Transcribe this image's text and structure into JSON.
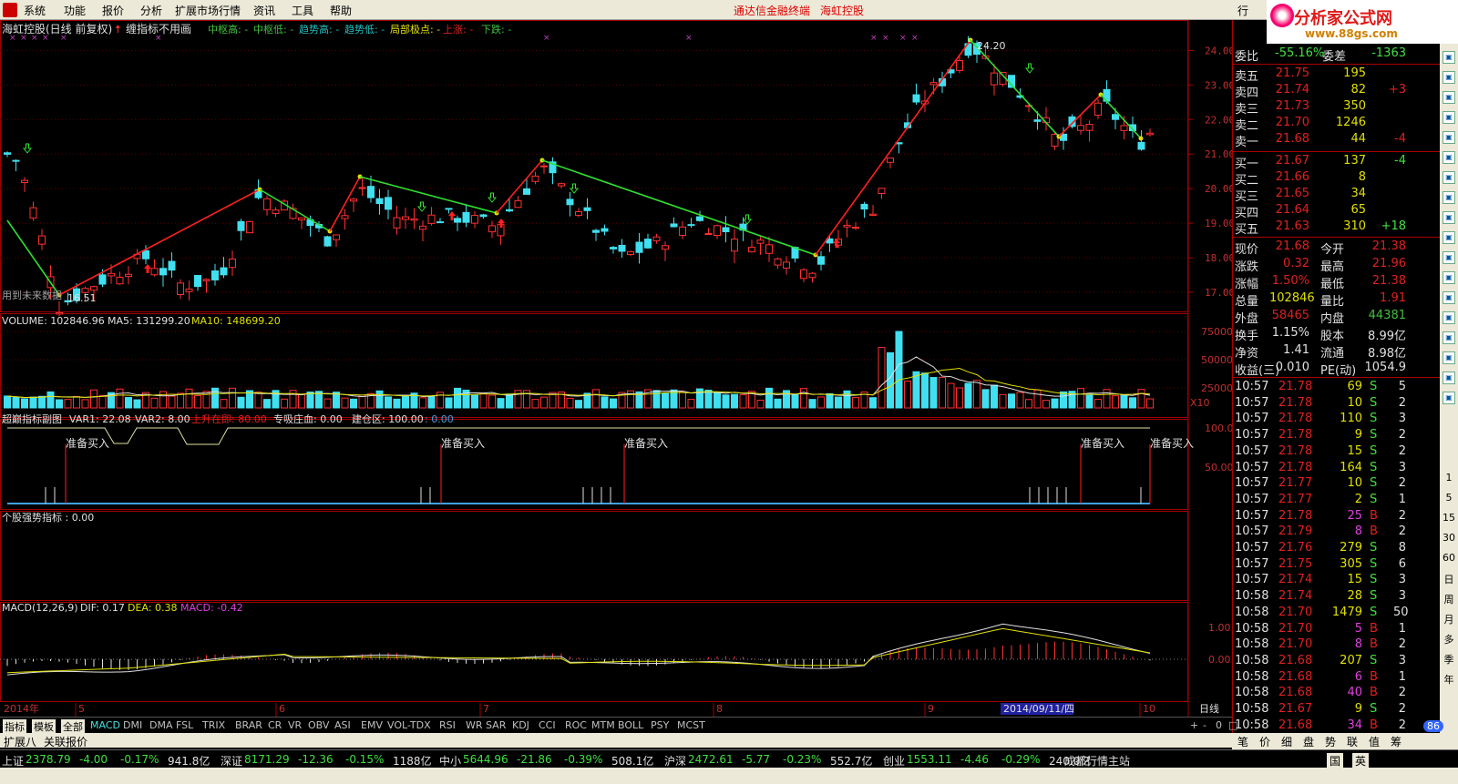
{
  "menu": {
    "items": [
      "系统",
      "功能",
      "报价",
      "分析",
      "扩展市场行情",
      "资讯",
      "工具",
      "帮助"
    ],
    "alert_left": "通达信金融终端",
    "alert_right": "海虹控股",
    "tab_right": "行"
  },
  "brand": {
    "name": "分析家公式网",
    "url": "www.88gs.com"
  },
  "header": {
    "title": "海虹控股(日线 前复权)",
    "tip": "缠指标不用画",
    "legend": [
      {
        "label": "中枢高: -",
        "color": "#40c040"
      },
      {
        "label": "中枢低: -",
        "color": "#40c040"
      },
      {
        "label": "趋势高: -",
        "color": "#20c0c0"
      },
      {
        "label": "趋势低: -",
        "color": "#20c0c0"
      },
      {
        "label": "局部极点: -",
        "color": "#e0e000"
      },
      {
        "label": "上涨: -",
        "color": "#e02020"
      },
      {
        "label": "下跌: -",
        "color": "#40c040"
      }
    ]
  },
  "price_axis": {
    "labels": [
      "24.00",
      "23.00",
      "22.00",
      "21.00",
      "20.00",
      "19.00",
      "18.00",
      "17.00"
    ],
    "min": 16.5,
    "max": 24.3
  },
  "annotations": {
    "high": "24.20",
    "low": "16.51",
    "future": "用到未来数据"
  },
  "volume": {
    "title": "VOLUME: 102846.96",
    "ma5": "MA5: 131299.20",
    "ma10": "MA10: 148699.20",
    "axis": [
      "75000",
      "50000",
      "25000"
    ],
    "multiplier": "X10"
  },
  "sub1": {
    "title": "超巅指标副图",
    "var1": "VAR1: 22.08",
    "var2": "VAR2: 8.00",
    "up": "上升在即: 80.00",
    "zh": "专吸庄血: 0.00",
    "jc": "建仓区: 100.00",
    "jc2": ": 0.00",
    "axis": [
      "100.0",
      "50.00"
    ],
    "signal": "准备买入",
    "signal_cut": "准备买入"
  },
  "sub2": {
    "title": "个股强势指标 : 0.00"
  },
  "macd": {
    "title": "MACD(12,26,9)",
    "dif": "DIF: 0.17",
    "dea": "DEA: 0.38",
    "macd": "MACD: -0.42",
    "axis": [
      "1.00",
      "0.00"
    ]
  },
  "date_axis": {
    "year": "2014年",
    "months": [
      "5",
      "6",
      "7",
      "8",
      "9",
      "10"
    ],
    "cursor": "2014/09/11/四",
    "period": "日线"
  },
  "tabs": [
    "指标",
    "模板",
    "全部",
    "MACD",
    "DMI",
    "DMA",
    "FSL",
    "TRIX",
    "BRAR",
    "CR",
    "VR",
    "OBV",
    "ASI",
    "EMV",
    "VOL-TDX",
    "RSI",
    "WR",
    "SAR",
    "KDJ",
    "CCI",
    "ROC",
    "MTM",
    "BOLL",
    "PSY",
    "MCST"
  ],
  "tabs_right": [
    "+",
    "-",
    "0",
    "□"
  ],
  "bottom_tabs": [
    "扩展八",
    "关联报价"
  ],
  "quote": {
    "weibi": {
      "label": "委比",
      "value": "-55.16%",
      "label2": "委差",
      "value2": "-1363"
    },
    "asks": [
      {
        "label": "卖五",
        "price": "21.75",
        "vol": "195",
        "chg": ""
      },
      {
        "label": "卖四",
        "price": "21.74",
        "vol": "82",
        "chg": "+3"
      },
      {
        "label": "卖三",
        "price": "21.73",
        "vol": "350",
        "chg": ""
      },
      {
        "label": "卖二",
        "price": "21.70",
        "vol": "1246",
        "chg": ""
      },
      {
        "label": "卖一",
        "price": "21.68",
        "vol": "44",
        "chg": "-4"
      }
    ],
    "bids": [
      {
        "label": "买一",
        "price": "21.67",
        "vol": "137",
        "chg": "-4"
      },
      {
        "label": "买二",
        "price": "21.66",
        "vol": "8",
        "chg": ""
      },
      {
        "label": "买三",
        "price": "21.65",
        "vol": "34",
        "chg": ""
      },
      {
        "label": "买四",
        "price": "21.64",
        "vol": "65",
        "chg": ""
      },
      {
        "label": "买五",
        "price": "21.63",
        "vol": "310",
        "chg": "+18"
      }
    ],
    "stats": [
      {
        "l1": "现价",
        "v1": "21.68",
        "c1": "#e02020",
        "l2": "今开",
        "v2": "21.38",
        "c2": "#e02020"
      },
      {
        "l1": "涨跌",
        "v1": "0.32",
        "c1": "#e02020",
        "l2": "最高",
        "v2": "21.96",
        "c2": "#e02020"
      },
      {
        "l1": "涨幅",
        "v1": "1.50%",
        "c1": "#e02020",
        "l2": "最低",
        "v2": "21.38",
        "c2": "#e02020"
      },
      {
        "l1": "总量",
        "v1": "102846",
        "c1": "#e0e000",
        "l2": "量比",
        "v2": "1.91",
        "c2": "#e02020"
      },
      {
        "l1": "外盘",
        "v1": "58465",
        "c1": "#e02020",
        "l2": "内盘",
        "v2": "44381",
        "c2": "#40c040"
      },
      {
        "l1": "换手",
        "v1": "1.15%",
        "c1": "#e0e0e0",
        "l2": "股本",
        "v2": "8.99亿",
        "c2": "#e0e0e0"
      },
      {
        "l1": "净资",
        "v1": "1.41",
        "c1": "#e0e0e0",
        "l2": "流通",
        "v2": "8.98亿",
        "c2": "#e0e0e0"
      },
      {
        "l1": "收益(三)",
        "v1": "0.010",
        "c1": "#e0e0e0",
        "l2": "PE(动)",
        "v2": "1054.9",
        "c2": "#e0e0e0"
      }
    ],
    "ticks": [
      {
        "t": "10:57",
        "p": "21.78",
        "v": "69",
        "s": "S",
        "n": "5"
      },
      {
        "t": "10:57",
        "p": "21.78",
        "v": "10",
        "s": "S",
        "n": "2"
      },
      {
        "t": "10:57",
        "p": "21.78",
        "v": "110",
        "s": "S",
        "n": "3"
      },
      {
        "t": "10:57",
        "p": "21.78",
        "v": "9",
        "s": "S",
        "n": "2"
      },
      {
        "t": "10:57",
        "p": "21.78",
        "v": "15",
        "s": "S",
        "n": "2"
      },
      {
        "t": "10:57",
        "p": "21.78",
        "v": "164",
        "s": "S",
        "n": "3"
      },
      {
        "t": "10:57",
        "p": "21.77",
        "v": "10",
        "s": "S",
        "n": "2"
      },
      {
        "t": "10:57",
        "p": "21.77",
        "v": "2",
        "s": "S",
        "n": "1"
      },
      {
        "t": "10:57",
        "p": "21.78",
        "v": "25",
        "s": "B",
        "n": "2"
      },
      {
        "t": "10:57",
        "p": "21.79",
        "v": "8",
        "s": "B",
        "n": "2"
      },
      {
        "t": "10:57",
        "p": "21.76",
        "v": "279",
        "s": "S",
        "n": "8"
      },
      {
        "t": "10:57",
        "p": "21.75",
        "v": "305",
        "s": "S",
        "n": "6"
      },
      {
        "t": "10:57",
        "p": "21.74",
        "v": "15",
        "s": "S",
        "n": "3"
      },
      {
        "t": "10:58",
        "p": "21.74",
        "v": "28",
        "s": "S",
        "n": "3"
      },
      {
        "t": "10:58",
        "p": "21.70",
        "v": "1479",
        "s": "S",
        "n": "50"
      },
      {
        "t": "10:58",
        "p": "21.70",
        "v": "5",
        "s": "B",
        "n": "1"
      },
      {
        "t": "10:58",
        "p": "21.70",
        "v": "8",
        "s": "B",
        "n": "2"
      },
      {
        "t": "10:58",
        "p": "21.68",
        "v": "207",
        "s": "S",
        "n": "3"
      },
      {
        "t": "10:58",
        "p": "21.68",
        "v": "6",
        "s": "B",
        "n": "1"
      },
      {
        "t": "10:58",
        "p": "21.68",
        "v": "40",
        "s": "B",
        "n": "2"
      },
      {
        "t": "10:58",
        "p": "21.67",
        "v": "9",
        "s": "S",
        "n": "2"
      },
      {
        "t": "10:58",
        "p": "21.68",
        "v": "34",
        "s": "B",
        "n": "2"
      }
    ]
  },
  "right_tabs": [
    "笔",
    "价",
    "细",
    "盘",
    "势",
    "联",
    "值",
    "筹"
  ],
  "side_labels": [
    "1",
    "5",
    "15",
    "30",
    "60",
    "日",
    "周",
    "月",
    "多",
    "季",
    "年"
  ],
  "status": [
    {
      "name": "上证",
      "price": "2378.79",
      "chg": "-4.00",
      "pct": "-0.17%",
      "amt": "941.8亿"
    },
    {
      "name": "深证",
      "price": "8171.29",
      "chg": "-12.36",
      "pct": "-0.15%",
      "amt": "1188亿"
    },
    {
      "name": "中小",
      "price": "5644.96",
      "chg": "-21.86",
      "pct": "-0.39%",
      "amt": "508.1亿"
    },
    {
      "name": "沪深",
      "price": "2472.61",
      "chg": "-5.77",
      "pct": "-0.23%",
      "amt": "552.7亿"
    },
    {
      "name": "创业",
      "price": "1553.11",
      "chg": "-4.46",
      "pct": "-0.29%",
      "amt": "240.0亿"
    }
  ],
  "server": "成都行情主站",
  "ime": [
    "国",
    "英"
  ],
  "badge": "86"
}
